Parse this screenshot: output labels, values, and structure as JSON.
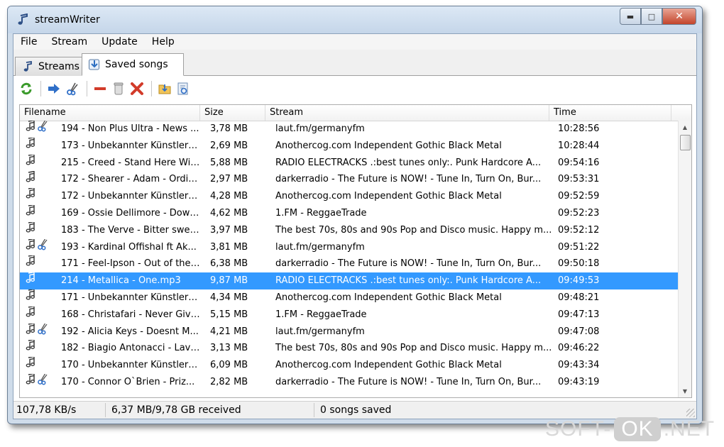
{
  "window": {
    "title": "streamWriter"
  },
  "menu": [
    "File",
    "Stream",
    "Update",
    "Help"
  ],
  "tabs": [
    {
      "label": "Streams",
      "icon": "note-icon"
    },
    {
      "label": "Saved songs",
      "icon": "saved-songs-icon"
    }
  ],
  "toolbar": [
    "refresh-icon",
    "arrow-right-icon",
    "cut-icon",
    "remove-icon",
    "recycle-bin-icon",
    "delete-icon",
    "import-folder-icon",
    "properties-icon"
  ],
  "list": {
    "columns": [
      "Filename",
      "Size",
      "Stream",
      "Time"
    ],
    "rows": [
      {
        "name": "194 - Non Plus Ultra - News ...",
        "size": "3,78 MB",
        "stream": "laut.fm/germanyfm",
        "time": "10:28:56",
        "cut": true
      },
      {
        "name": "173 - Unbekannter Künstler - D...",
        "size": "2,69 MB",
        "stream": "Anothercog.com Independent Gothic Black Metal",
        "time": "10:28:44",
        "cut": false
      },
      {
        "name": "215 - Creed - Stand Here With ...",
        "size": "5,88 MB",
        "stream": "RADIO ELECTRACKS .:best tunes only:. Punk Hardcore A...",
        "time": "09:54:16",
        "cut": false
      },
      {
        "name": "172 - Shearer - Adam - Ordinar...",
        "size": "2,97 MB",
        "stream": "darkerradio - The Future is NOW! - Tune In, Turn On, Bur...",
        "time": "09:53:31",
        "cut": false
      },
      {
        "name": "172 - Unbekannter Künstler - A...",
        "size": "4,28 MB",
        "stream": "Anothercog.com Independent Gothic Black Metal",
        "time": "09:52:59",
        "cut": false
      },
      {
        "name": "169 - Ossie Dellimore - Downpr...",
        "size": "4,62 MB",
        "stream": "1.FM - ReggaeTrade",
        "time": "09:52:23",
        "cut": false
      },
      {
        "name": "183 - The Verve - Bitter sweet ...",
        "size": "3,97 MB",
        "stream": "The best 70s, 80s and 90s Pop and Disco music. Happy m...",
        "time": "09:52:12",
        "cut": false
      },
      {
        "name": "193 - Kardinal Offishal ft Ak...",
        "size": "3,81 MB",
        "stream": "laut.fm/germanyfm",
        "time": "09:51:22",
        "cut": true
      },
      {
        "name": "171 - Feel-Ipson - Out of the S...",
        "size": "6,38 MB",
        "stream": "darkerradio - The Future is NOW! - Tune In, Turn On, Bur...",
        "time": "09:50:18",
        "cut": false
      },
      {
        "name": "214 - Metallica - One.mp3",
        "size": "9,87 MB",
        "stream": "RADIO ELECTRACKS .:best tunes only:. Punk Hardcore A...",
        "time": "09:49:53",
        "cut": false,
        "selected": true
      },
      {
        "name": "171 - Unbekannter Künstler - Di...",
        "size": "4,34 MB",
        "stream": "Anothercog.com Independent Gothic Black Metal",
        "time": "09:48:21",
        "cut": false
      },
      {
        "name": "168 - Christafari - Never Give in...",
        "size": "5,15 MB",
        "stream": "1.FM - ReggaeTrade",
        "time": "09:47:13",
        "cut": false
      },
      {
        "name": "192 - Alicia Keys - Doesnt M...",
        "size": "4,21 MB",
        "stream": "laut.fm/germanyfm",
        "time": "09:47:08",
        "cut": true
      },
      {
        "name": "182 - Biagio Antonacci - Lavore...",
        "size": "3,13 MB",
        "stream": "The best 70s, 80s and 90s Pop and Disco music. Happy m...",
        "time": "09:46:22",
        "cut": false
      },
      {
        "name": "170 - Unbekannter Künstler - A...",
        "size": "6,09 MB",
        "stream": "Anothercog.com Independent Gothic Black Metal",
        "time": "09:43:34",
        "cut": false
      },
      {
        "name": "170 - Connor O`Brien - Priz...",
        "size": "2,82 MB",
        "stream": "darkerradio - The Future is NOW! - Tune In, Turn On, Bur...",
        "time": "09:43:19",
        "cut": true
      }
    ]
  },
  "status": {
    "speed": "107,78 KB/s",
    "received": "6,37 MB/9,78 GB received",
    "saved": "0 songs saved"
  },
  "watermark": {
    "left": "SOFT-",
    "middle": "OK",
    "right": ".NET"
  },
  "colors": {
    "selection": "#3399ff",
    "close": "#c4452c"
  }
}
